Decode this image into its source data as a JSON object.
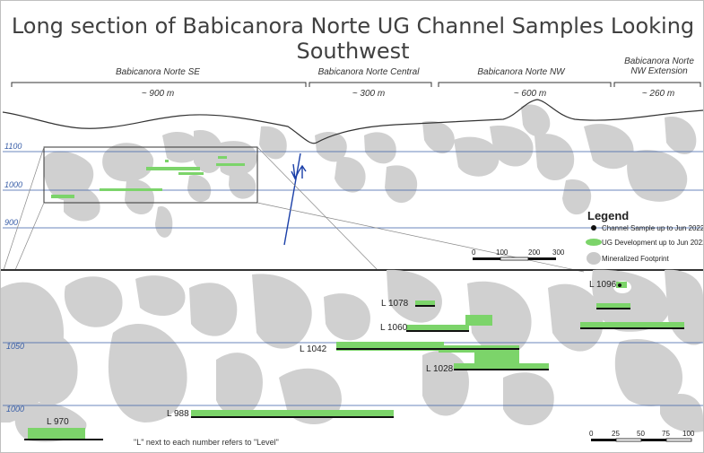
{
  "title": "Long section of Babicanora Norte UG Channel Samples Looking Southwest",
  "zones": [
    {
      "name": "Babicanora Norte SE",
      "length": "~ 900 m"
    },
    {
      "name": "Babicanora Norte Central",
      "length": "~ 300 m"
    },
    {
      "name": "Babicanora Norte NW",
      "length": "~ 600 m"
    },
    {
      "name": "Babicanora Norte NW Extension",
      "length": "~ 260 m"
    }
  ],
  "elevations_top": [
    "1100",
    "1000",
    "900"
  ],
  "elevations_bottom": [
    "1050",
    "1000"
  ],
  "levels": [
    "L 1096",
    "L 1078",
    "L 1060",
    "L 1042",
    "L 1028",
    "L 988",
    "L 970"
  ],
  "legend": {
    "title": "Legend",
    "items": [
      {
        "label": "Channel Sample up to Jun 2022",
        "icon": "black-dot-icon"
      },
      {
        "label": "UG Development up to Jun 2022",
        "icon": "green-development-icon"
      },
      {
        "label": "Mineralized Footprint",
        "icon": "grey-footprint-icon"
      }
    ]
  },
  "scale_top": [
    "0",
    "100",
    "200",
    "300"
  ],
  "scale_bottom": [
    "0",
    "25",
    "50",
    "75",
    "100"
  ],
  "note": "\"L\" next to each number refers to \"Level\"",
  "colors": {
    "elevation_line": "#3a5fa8",
    "footprint": "#c9c9c9",
    "development": "#7cd46a",
    "fault": "#1a3fa8"
  }
}
